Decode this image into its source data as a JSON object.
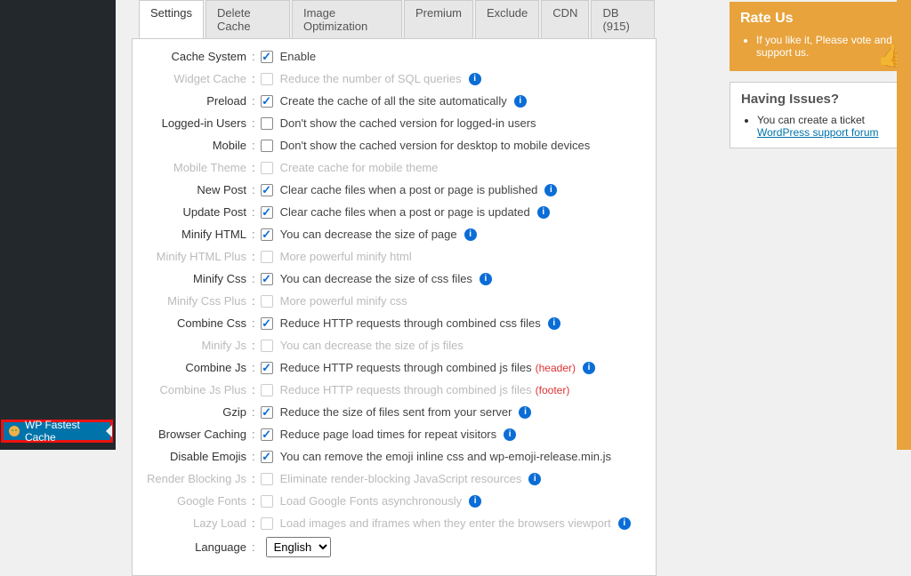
{
  "sidebar": {
    "active_item": "WP Fastest Cache"
  },
  "tabs": [
    {
      "label": "Settings",
      "active": true
    },
    {
      "label": "Delete Cache",
      "active": false
    },
    {
      "label": "Image Optimization",
      "active": false
    },
    {
      "label": "Premium",
      "active": false
    },
    {
      "label": "Exclude",
      "active": false
    },
    {
      "label": "CDN",
      "active": false
    },
    {
      "label": "DB (915)",
      "active": false
    }
  ],
  "settings": {
    "cache_system": {
      "label": "Cache System",
      "checked": true,
      "desc": "Enable",
      "muted": false,
      "info": false
    },
    "widget_cache": {
      "label": "Widget Cache",
      "checked": false,
      "desc": "Reduce the number of SQL queries",
      "muted": true,
      "info": true
    },
    "preload": {
      "label": "Preload",
      "checked": true,
      "desc": "Create the cache of all the site automatically",
      "muted": false,
      "info": true
    },
    "logged_in": {
      "label": "Logged-in Users",
      "checked": false,
      "desc": "Don't show the cached version for logged-in users",
      "muted": false,
      "info": false
    },
    "mobile": {
      "label": "Mobile",
      "checked": false,
      "desc": "Don't show the cached version for desktop to mobile devices",
      "muted": false,
      "info": false
    },
    "mobile_theme": {
      "label": "Mobile Theme",
      "checked": false,
      "desc": "Create cache for mobile theme",
      "muted": true,
      "info": false
    },
    "new_post": {
      "label": "New Post",
      "checked": true,
      "desc": "Clear cache files when a post or page is published",
      "muted": false,
      "info": true
    },
    "update_post": {
      "label": "Update Post",
      "checked": true,
      "desc": "Clear cache files when a post or page is updated",
      "muted": false,
      "info": true
    },
    "minify_html": {
      "label": "Minify HTML",
      "checked": true,
      "desc": "You can decrease the size of page",
      "muted": false,
      "info": true
    },
    "minify_html_plus": {
      "label": "Minify HTML Plus",
      "checked": false,
      "desc": "More powerful minify html",
      "muted": true,
      "info": false
    },
    "minify_css": {
      "label": "Minify Css",
      "checked": true,
      "desc": "You can decrease the size of css files",
      "muted": false,
      "info": true
    },
    "minify_css_plus": {
      "label": "Minify Css Plus",
      "checked": false,
      "desc": "More powerful minify css",
      "muted": true,
      "info": false
    },
    "combine_css": {
      "label": "Combine Css",
      "checked": true,
      "desc": "Reduce HTTP requests through combined css files",
      "muted": false,
      "info": true
    },
    "minify_js": {
      "label": "Minify Js",
      "checked": false,
      "desc": "You can decrease the size of js files",
      "muted": true,
      "info": false
    },
    "combine_js": {
      "label": "Combine Js",
      "checked": true,
      "desc": "Reduce HTTP requests through combined js files",
      "suffix": "(header)",
      "muted": false,
      "info": true
    },
    "combine_js_plus": {
      "label": "Combine Js Plus",
      "checked": false,
      "desc": "Reduce HTTP requests through combined js files",
      "suffix": "(footer)",
      "muted": true,
      "info": false
    },
    "gzip": {
      "label": "Gzip",
      "checked": true,
      "desc": "Reduce the size of files sent from your server",
      "muted": false,
      "info": true
    },
    "browser_caching": {
      "label": "Browser Caching",
      "checked": true,
      "desc": "Reduce page load times for repeat visitors",
      "muted": false,
      "info": true
    },
    "disable_emojis": {
      "label": "Disable Emojis",
      "checked": true,
      "desc": "You can remove the emoji inline css and wp-emoji-release.min.js",
      "muted": false,
      "info": false
    },
    "render_blocking": {
      "label": "Render Blocking Js",
      "checked": false,
      "desc": "Eliminate render-blocking JavaScript resources",
      "muted": true,
      "info": true
    },
    "google_fonts": {
      "label": "Google Fonts",
      "checked": false,
      "desc": "Load Google Fonts asynchronously",
      "muted": true,
      "info": true
    },
    "lazy_load": {
      "label": "Lazy Load",
      "checked": false,
      "desc": "Load images and iframes when they enter the browsers viewport",
      "muted": true,
      "info": true
    }
  },
  "language": {
    "label": "Language",
    "value": "English"
  },
  "rate_box": {
    "title": "Rate Us",
    "text": "If you like it, Please vote and support us."
  },
  "issues_box": {
    "title": "Having Issues?",
    "text": "You can create a ticket",
    "link": "WordPress support forum"
  }
}
